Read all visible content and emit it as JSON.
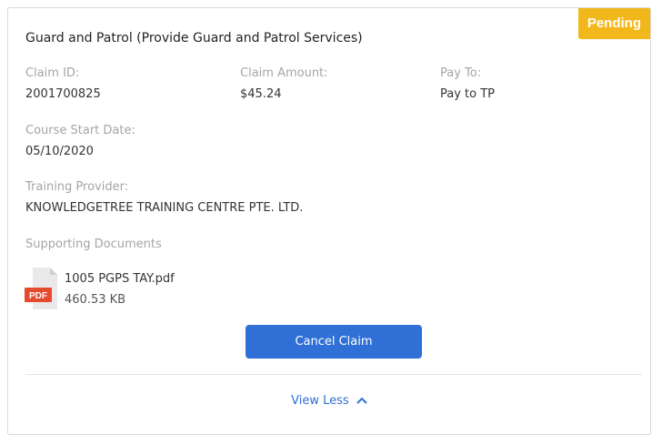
{
  "claim": {
    "status": "Pending",
    "title": "Guard and Patrol (Provide Guard and Patrol Services)",
    "claim_id_label": "Claim ID:",
    "claim_id": "2001700825",
    "claim_amount_label": "Claim Amount:",
    "claim_amount": "$45.24",
    "pay_to_label": "Pay To:",
    "pay_to": "Pay to TP",
    "course_start_label": "Course Start Date:",
    "course_start": "05/10/2020",
    "provider_label": "Training Provider:",
    "provider": "KNOWLEDGETREE TRAINING CENTRE PTE. LTD.",
    "documents_label": "Supporting Documents"
  },
  "document": {
    "icon": "pdf-file-icon",
    "badge_text": "PDF",
    "file_name": "1005 PGPS TAY.pdf",
    "file_size": "460.53 KB"
  },
  "actions": {
    "cancel_label": "Cancel Claim",
    "view_less_label": "View Less",
    "view_less_icon": "chevron-up-icon"
  },
  "colors": {
    "pending": "#f2b81b",
    "primary": "#2f6fd6",
    "pdf_badge": "#e64a2e"
  }
}
